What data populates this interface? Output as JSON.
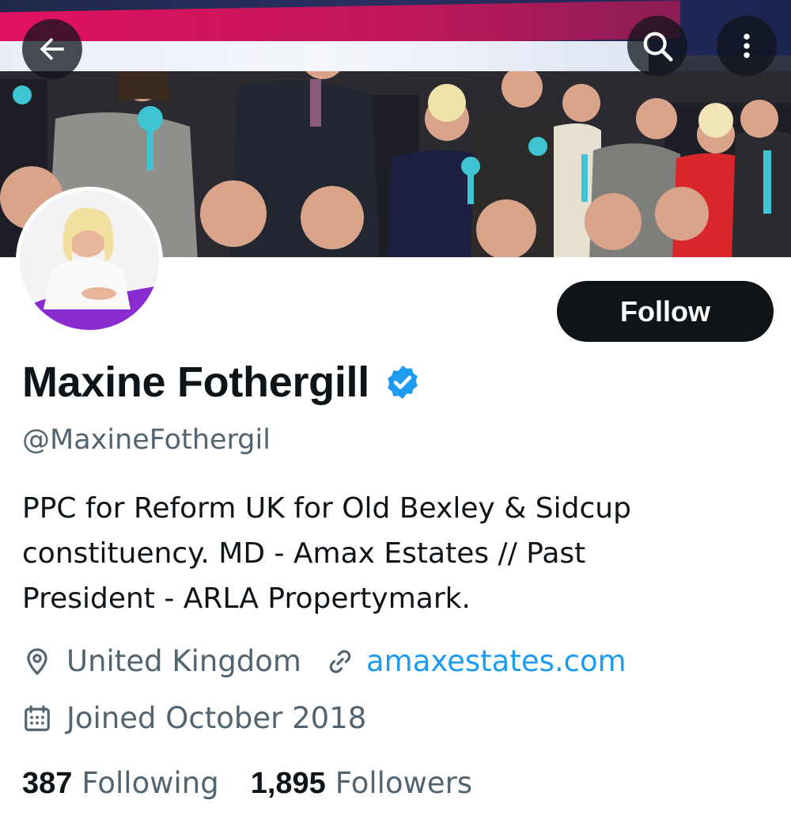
{
  "profile": {
    "display_name": "Maxine Fothergill",
    "handle": "@MaxineFothergil",
    "bio_lines": [
      "PPC for Reform UK for Old Bexley & Sidcup",
      "constituency. MD - Amax Estates // Past",
      "President - ARLA Propertymark."
    ],
    "location": "United Kingdom",
    "website": "amaxestates.com",
    "joined": "Joined October 2018",
    "following_count": "387",
    "following_label": "Following",
    "followers_count": "1,895",
    "followers_label": "Followers",
    "verified": true
  },
  "actions": {
    "follow_label": "Follow"
  },
  "icons": {
    "back": "back-arrow-icon",
    "search": "search-icon",
    "more": "more-vertical-icon",
    "verified": "verified-badge-icon",
    "location": "location-pin-icon",
    "link": "link-icon",
    "calendar": "calendar-icon"
  },
  "colors": {
    "text_primary": "#0f1419",
    "text_secondary": "#536471",
    "link": "#1d9bf0",
    "verified": "#1d9bf0",
    "button_dark": "#0f1419"
  }
}
